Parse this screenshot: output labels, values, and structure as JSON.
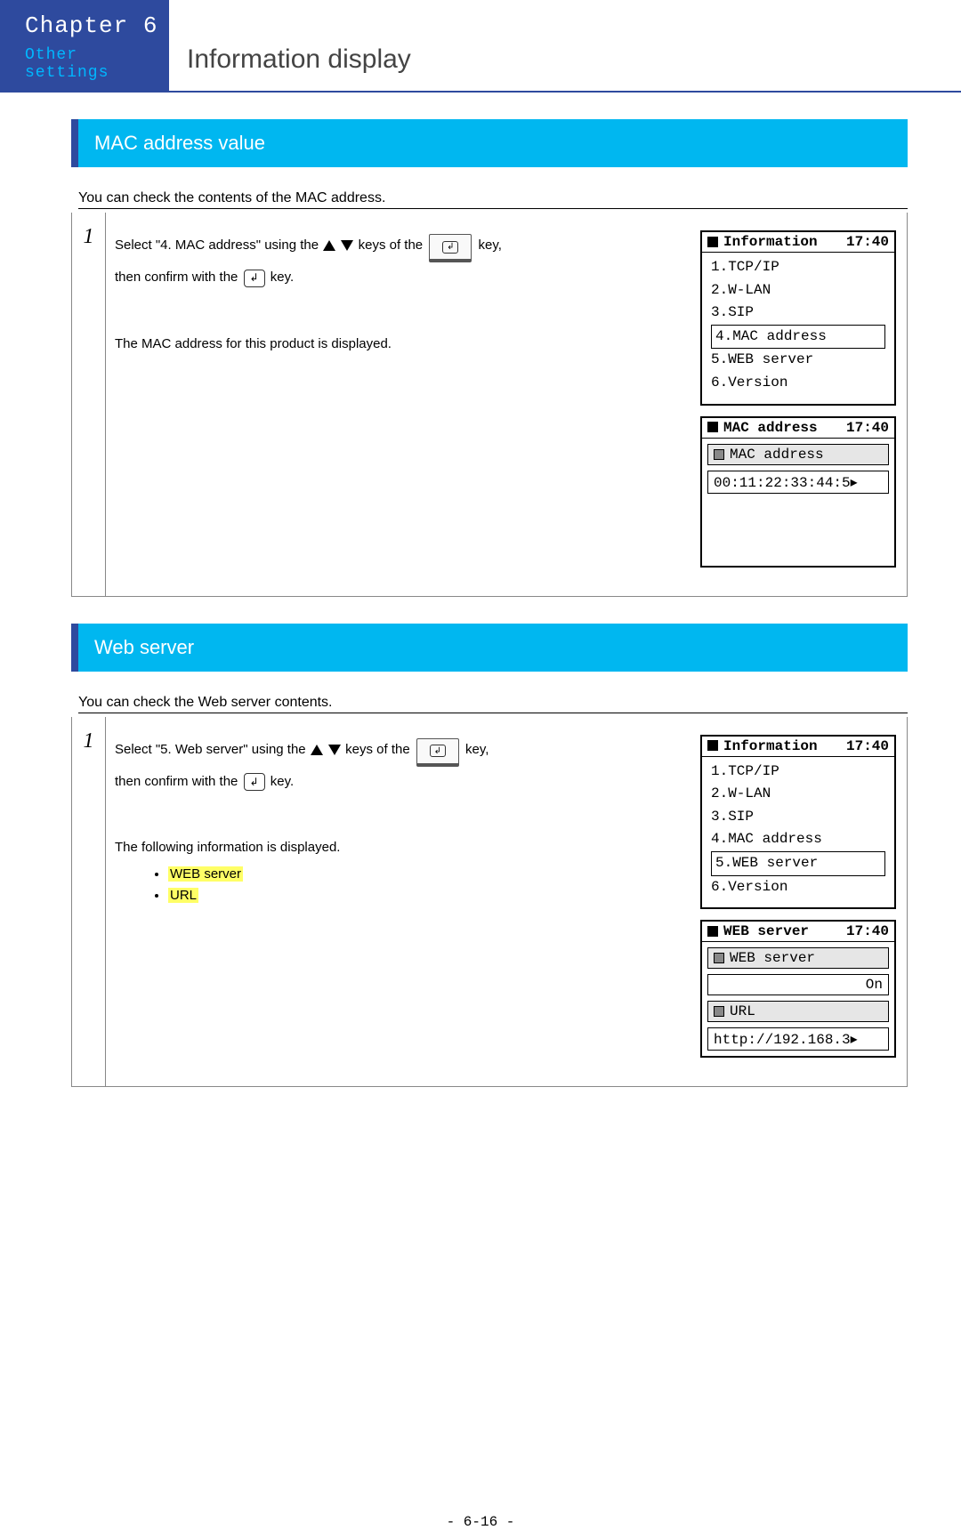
{
  "chapter": {
    "title": "Chapter 6",
    "subtitle": "Other settings",
    "page_title": "Information display"
  },
  "mac_section": {
    "header": "MAC address value",
    "intro": "You can check the contents of the MAC address.",
    "step_num": "1",
    "text1a": "Select \"4. MAC address\" using the ",
    "text1b": " keys of the ",
    "text1c": " key,",
    "text2a": "then confirm with the ",
    "text2b": " key.",
    "text3": "The MAC address for this product is displayed.",
    "screen1": {
      "title": "Information",
      "time": "17:40",
      "items": [
        "1.TCP/IP",
        "2.W-LAN",
        "3.SIP",
        "4.MAC address",
        "5.WEB server",
        "6.Version"
      ],
      "selected_index": 3
    },
    "screen2": {
      "title": "MAC address",
      "time": "17:40",
      "sub": "MAC address",
      "value": "00:11:22:33:44:5▸"
    }
  },
  "web_section": {
    "header": "Web server",
    "intro": "You can check the Web server contents.",
    "step_num": "1",
    "text1a": "Select \"5. Web server\" using the ",
    "text1b": " keys of the ",
    "text1c": " key,",
    "text2a": "then confirm with the ",
    "text2b": " key.",
    "text3": "The following information is displayed.",
    "bullets": [
      "WEB server",
      "URL"
    ],
    "screen1": {
      "title": "Information",
      "time": "17:40",
      "items": [
        "1.TCP/IP",
        "2.W-LAN",
        "3.SIP",
        "4.MAC address",
        "5.WEB server",
        "6.Version"
      ],
      "selected_index": 4
    },
    "screen2": {
      "title": "WEB server",
      "time": "17:40",
      "sub1": "WEB server",
      "val1": "On",
      "sub2": "URL",
      "val2": "http://192.168.3▸"
    }
  },
  "page_number": "- 6-16 -"
}
